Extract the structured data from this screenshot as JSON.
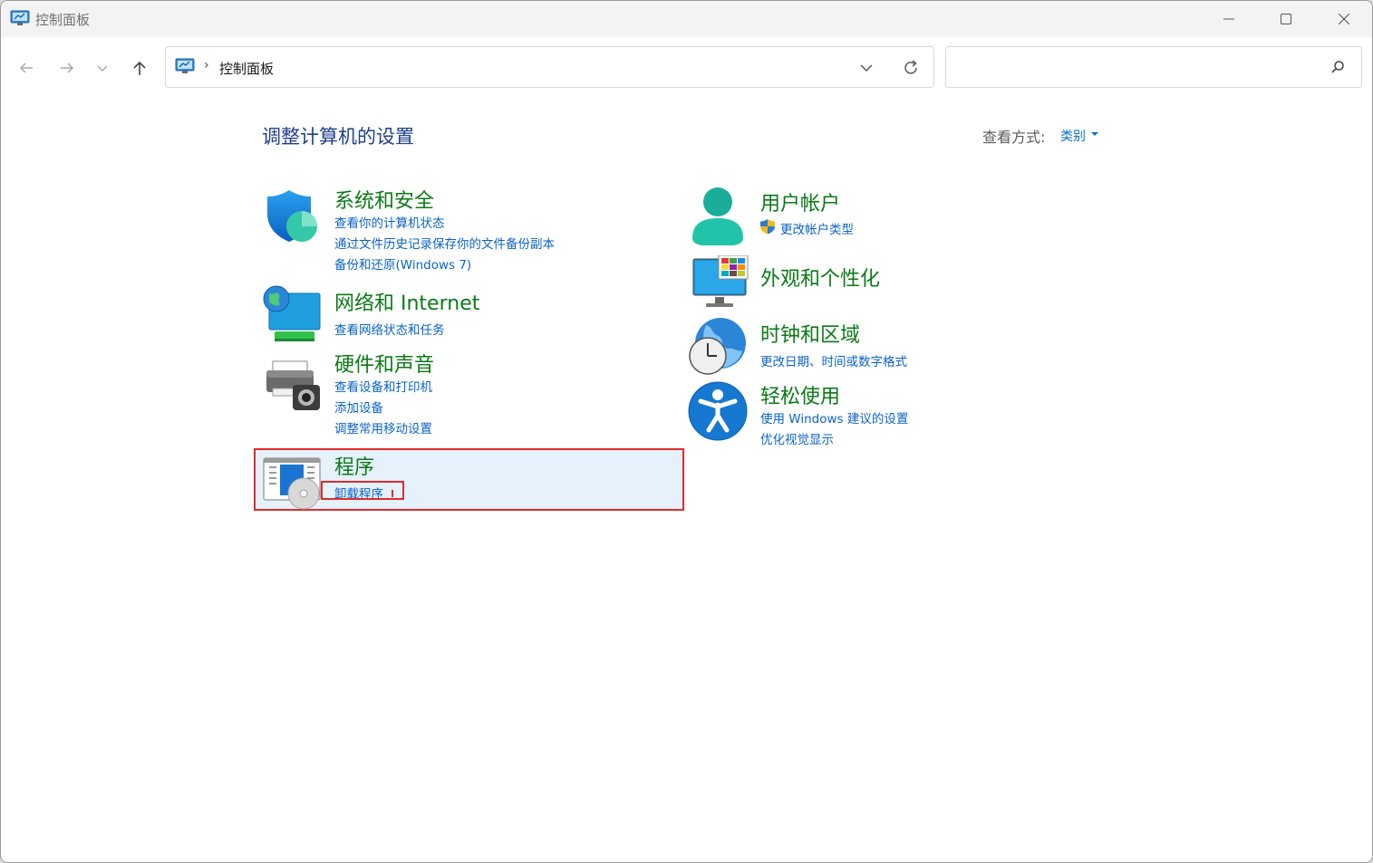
{
  "window": {
    "title": "控制面板"
  },
  "address_bar": {
    "path": "控制面板",
    "separator": "›"
  },
  "search": {
    "placeholder": "",
    "value": ""
  },
  "main": {
    "title": "调整计算机的设置",
    "view_by_label": "查看方式:",
    "view_by_value": "类别"
  },
  "categories": [
    {
      "name": "system-security",
      "title": "系统和安全",
      "icon": "shield-icon",
      "links": [
        "查看你的计算机状态",
        "通过文件历史记录保存你的文件备份副本",
        "备份和还原(Windows 7)"
      ]
    },
    {
      "name": "network-internet",
      "title": "网络和 Internet",
      "icon": "globe-monitor-icon",
      "links": [
        "查看网络状态和任务"
      ]
    },
    {
      "name": "hardware-sound",
      "title": "硬件和声音",
      "icon": "printer-icon",
      "links": [
        "查看设备和打印机",
        "添加设备",
        "调整常用移动设置"
      ]
    },
    {
      "name": "programs",
      "title": "程序",
      "icon": "programs-disc-icon",
      "links": [
        "卸载程序"
      ]
    },
    {
      "name": "user-accounts",
      "title": "用户帐户",
      "icon": "user-icon",
      "links": [
        "更改帐户类型"
      ]
    },
    {
      "name": "appearance",
      "title": "外观和个性化",
      "icon": "monitor-palette-icon",
      "links": []
    },
    {
      "name": "clock-region",
      "title": "时钟和区域",
      "icon": "globe-clock-icon",
      "links": [
        "更改日期、时间或数字格式"
      ]
    },
    {
      "name": "ease-of-access",
      "title": "轻松使用",
      "icon": "accessibility-icon",
      "links": [
        "使用 Windows 建议的设置",
        "优化视觉显示"
      ]
    }
  ],
  "colors": {
    "category_title": "#0b7a17",
    "link": "#0a63c9",
    "page_title": "#1f3f8f",
    "highlight": "#e02b2b"
  }
}
